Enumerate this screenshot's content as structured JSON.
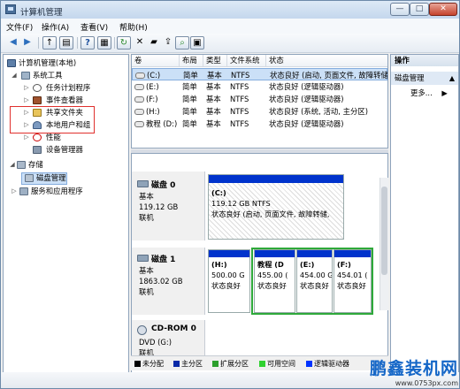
{
  "window": {
    "title": "计算机管理",
    "min": "—",
    "max": "□",
    "close": "✕"
  },
  "menu": [
    "文件(F)",
    "操作(A)",
    "查看(V)",
    "帮助(H)"
  ],
  "tree": [
    {
      "label": "计算机管理(本地)"
    },
    {
      "label": "系统工具"
    },
    {
      "label": "任务计划程序"
    },
    {
      "label": "事件查看器"
    },
    {
      "label": "共享文件夹"
    },
    {
      "label": "本地用户和组"
    },
    {
      "label": "性能"
    },
    {
      "label": "设备管理器"
    },
    {
      "label": "存储"
    },
    {
      "label": "磁盘管理"
    },
    {
      "label": "服务和应用程序"
    }
  ],
  "volumes": {
    "headers": [
      "卷",
      "布局",
      "类型",
      "文件系统",
      "状态"
    ],
    "rows": [
      {
        "vol": "(C:)",
        "layout": "简单",
        "type": "基本",
        "fs": "NTFS",
        "status": "状态良好 (启动, 页面文件, 故障转储"
      },
      {
        "vol": "(E:)",
        "layout": "简单",
        "type": "基本",
        "fs": "NTFS",
        "status": "状态良好 (逻辑驱动器)"
      },
      {
        "vol": "(F:)",
        "layout": "简单",
        "type": "基本",
        "fs": "NTFS",
        "status": "状态良好 (逻辑驱动器)"
      },
      {
        "vol": "(H:)",
        "layout": "简单",
        "type": "基本",
        "fs": "NTFS",
        "status": "状态良好 (系统, 活动, 主分区)"
      },
      {
        "vol": "教程 (D:)",
        "layout": "简单",
        "type": "基本",
        "fs": "NTFS",
        "status": "状态良好 (逻辑驱动器)"
      }
    ]
  },
  "disks": [
    {
      "name": "磁盘 0",
      "type": "基本",
      "size": "119.12 GB",
      "state": "联机",
      "partitions": [
        {
          "title": "(C:)",
          "size": "119.12 GB NTFS",
          "status": "状态良好 (启动, 页面文件, 故障转储,"
        }
      ]
    },
    {
      "name": "磁盘 1",
      "type": "基本",
      "size": "1863.02 GB",
      "state": "联机",
      "partitions": [
        {
          "title": "(H:)",
          "size": "500.00 G",
          "status": "状态良好"
        },
        {
          "title": "教程 (D",
          "size": "455.00 (",
          "status": "状态良好"
        },
        {
          "title": "(E:)",
          "size": "454.00 G",
          "status": "状态良好"
        },
        {
          "title": "(F:)",
          "size": "454.01 (",
          "status": "状态良好"
        }
      ]
    },
    {
      "name": "CD-ROM 0",
      "type": "DVD (G:)",
      "size": "",
      "state": "联机",
      "partitions": []
    }
  ],
  "legend": [
    {
      "label": "未分配",
      "color": "#000000"
    },
    {
      "label": "主分区",
      "color": "#0a2aa8"
    },
    {
      "label": "扩展分区",
      "color": "#2c9f2c"
    },
    {
      "label": "可用空间",
      "color": "#2fd12f"
    },
    {
      "label": "逻辑驱动器",
      "color": "#0033ff"
    }
  ],
  "actions": {
    "header": "操作",
    "item": "磁盘管理",
    "more": "更多..."
  },
  "watermark": {
    "main": "鹏鑫装机网",
    "url": "www.0753px.com"
  },
  "colors": {
    "primary_partition": "#0033cc",
    "selection": "#cbe0f7",
    "highlight_red": "#e0302d",
    "highlight_green": "#2ea93a"
  }
}
